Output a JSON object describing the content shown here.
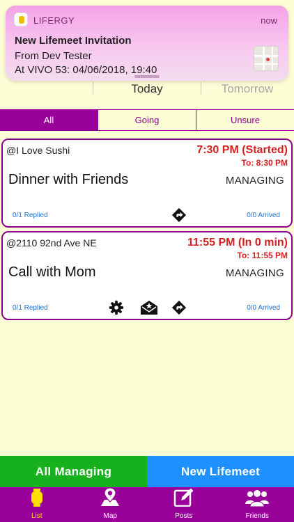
{
  "notification": {
    "app_name": "LIFERGY",
    "time": "now",
    "title": "New Lifemeet Invitation",
    "line1": "From Dev Tester",
    "line2": "At VIVO 53: 04/06/2018, 19:40"
  },
  "day_tabs": {
    "today": "Today",
    "tomorrow": "Tomorrow"
  },
  "filters": [
    {
      "label": "All",
      "active": true
    },
    {
      "label": "Going",
      "active": false
    },
    {
      "label": "Unsure",
      "active": false
    }
  ],
  "events": [
    {
      "location": "@I Love Sushi",
      "time": "7:30 PM (Started)",
      "to": "To: 8:30 PM",
      "title": "Dinner with Friends",
      "role": "MANAGING",
      "replied": "0/1 Replied",
      "arrived": "0/0 Arrived",
      "icons": [
        "directions-icon"
      ]
    },
    {
      "location": "@2110 92nd Ave NE",
      "time": "11:55 PM (In 0 min)",
      "to": "To: 11:55 PM",
      "title": "Call with Mom",
      "role": "MANAGING",
      "replied": "0/1 Replied",
      "arrived": "0/0 Arrived",
      "icons": [
        "gear-icon",
        "invite-mail-icon",
        "directions-icon"
      ]
    }
  ],
  "actions": {
    "all_managing": "All Managing",
    "new_lifemeet": "New Lifemeet"
  },
  "tabbar": [
    {
      "label": "List",
      "icon": "list-icon",
      "active": true
    },
    {
      "label": "Map",
      "icon": "map-pin-icon",
      "active": false
    },
    {
      "label": "Posts",
      "icon": "compose-icon",
      "active": false
    },
    {
      "label": "Friends",
      "icon": "friends-icon",
      "active": false
    }
  ],
  "colors": {
    "brand_purple": "#990099",
    "background": "#fdfdd6",
    "time_red": "#d42020",
    "managing_green": "#16b11c",
    "new_blue": "#1e90ff",
    "active_tab_yellow": "#ffe000"
  }
}
